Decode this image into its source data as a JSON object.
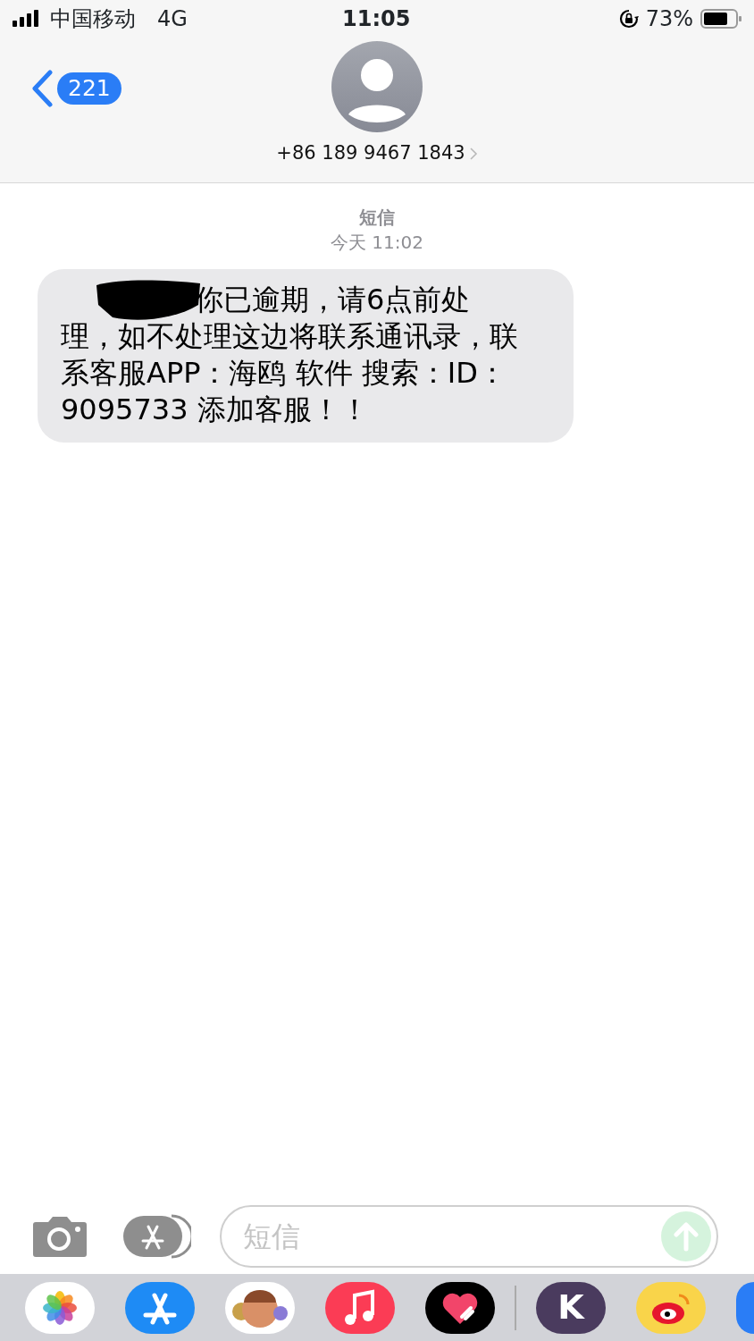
{
  "status_bar": {
    "carrier": "中国移动",
    "network": "4G",
    "time": "11:05",
    "battery": "73%"
  },
  "header": {
    "back_count": "221",
    "contact": "+86 189 9467 1843"
  },
  "thread": {
    "service": "短信",
    "timestamp": "今天 11:02",
    "messages": [
      {
        "text": "你已逾期，请6点前处理，如不处理这边将联系通讯录，联系客服APP：海鸥 软件 搜索：ID：9095733 添加客服！！",
        "redacted": true
      }
    ]
  },
  "composer": {
    "placeholder": "短信",
    "send_disabled": true
  },
  "dock": [
    {
      "kind": "photos"
    },
    {
      "kind": "appstore"
    },
    {
      "kind": "memoji"
    },
    {
      "kind": "music"
    },
    {
      "kind": "heart"
    },
    {
      "kind": "divider"
    },
    {
      "kind": "letter",
      "label": "K"
    },
    {
      "kind": "weibo"
    },
    {
      "kind": "partial"
    }
  ]
}
